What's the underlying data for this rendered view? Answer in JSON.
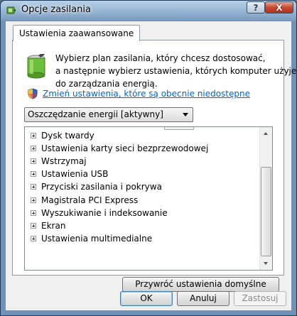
{
  "window": {
    "title": "Opcje zasilania",
    "help_label": "?",
    "close_label": "X"
  },
  "tab": {
    "label": "Ustawienia zaawansowane"
  },
  "description": {
    "line1": "Wybierz plan zasilania, który chcesz dostosować,",
    "line2": "a następnie wybierz ustawienia, których komputer użyje",
    "line3": "do zarządzania energią."
  },
  "change_link": "Zmień ustawienia, które są obecnie niedostępne",
  "plan_select": {
    "value": "Oszczędzanie energii [aktywny]"
  },
  "tree_items": [
    "Dysk twardy",
    "Ustawienia karty sieci bezprzewodowej",
    "Wstrzymaj",
    "Ustawienia USB",
    "Przyciski zasilania i pokrywa",
    "Magistrala PCI Express",
    "Wyszukiwanie i indeksowanie",
    "Ekran",
    "Ustawienia multimedialne"
  ],
  "restore_button": "Przywróć ustawienia domyślne planu",
  "buttons": {
    "ok": "OK",
    "cancel": "Anuluj",
    "apply": "Zastosuj"
  },
  "icons": {
    "app": "power-plug-icon",
    "battery": "battery-icon",
    "shield": "uac-shield-icon"
  },
  "colors": {
    "link": "#0066cc",
    "close": "#c84a2f"
  }
}
